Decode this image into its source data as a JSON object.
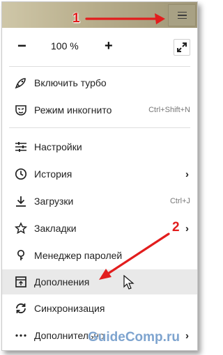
{
  "annotations": {
    "marker1": "1",
    "marker2": "2",
    "accent": "#e21d1d"
  },
  "zoom": {
    "minus": "−",
    "value": "100 %",
    "plus": "+",
    "fullscreen_icon": "expand-icon"
  },
  "menu": {
    "items": [
      {
        "label": "Включить турбо",
        "icon": "rocket-icon"
      },
      {
        "label": "Режим инкогнито",
        "icon": "incognito-mask-icon",
        "shortcut": "Ctrl+Shift+N"
      },
      {
        "label": "Настройки",
        "icon": "sliders-icon"
      },
      {
        "label": "История",
        "icon": "clock-icon",
        "submenu": "›"
      },
      {
        "label": "Загрузки",
        "icon": "download-icon",
        "shortcut": "Ctrl+J"
      },
      {
        "label": "Закладки",
        "icon": "star-icon",
        "submenu": "›"
      },
      {
        "label": "Менеджер паролей",
        "icon": "key-icon"
      },
      {
        "label": "Дополнения",
        "icon": "extension-icon",
        "highlighted": true
      },
      {
        "label": "Синхронизация",
        "icon": "sync-icon"
      },
      {
        "label": "Дополнительно",
        "icon": "more-dots-icon",
        "submenu": "›"
      }
    ]
  },
  "watermark": "GuideComp.ru"
}
